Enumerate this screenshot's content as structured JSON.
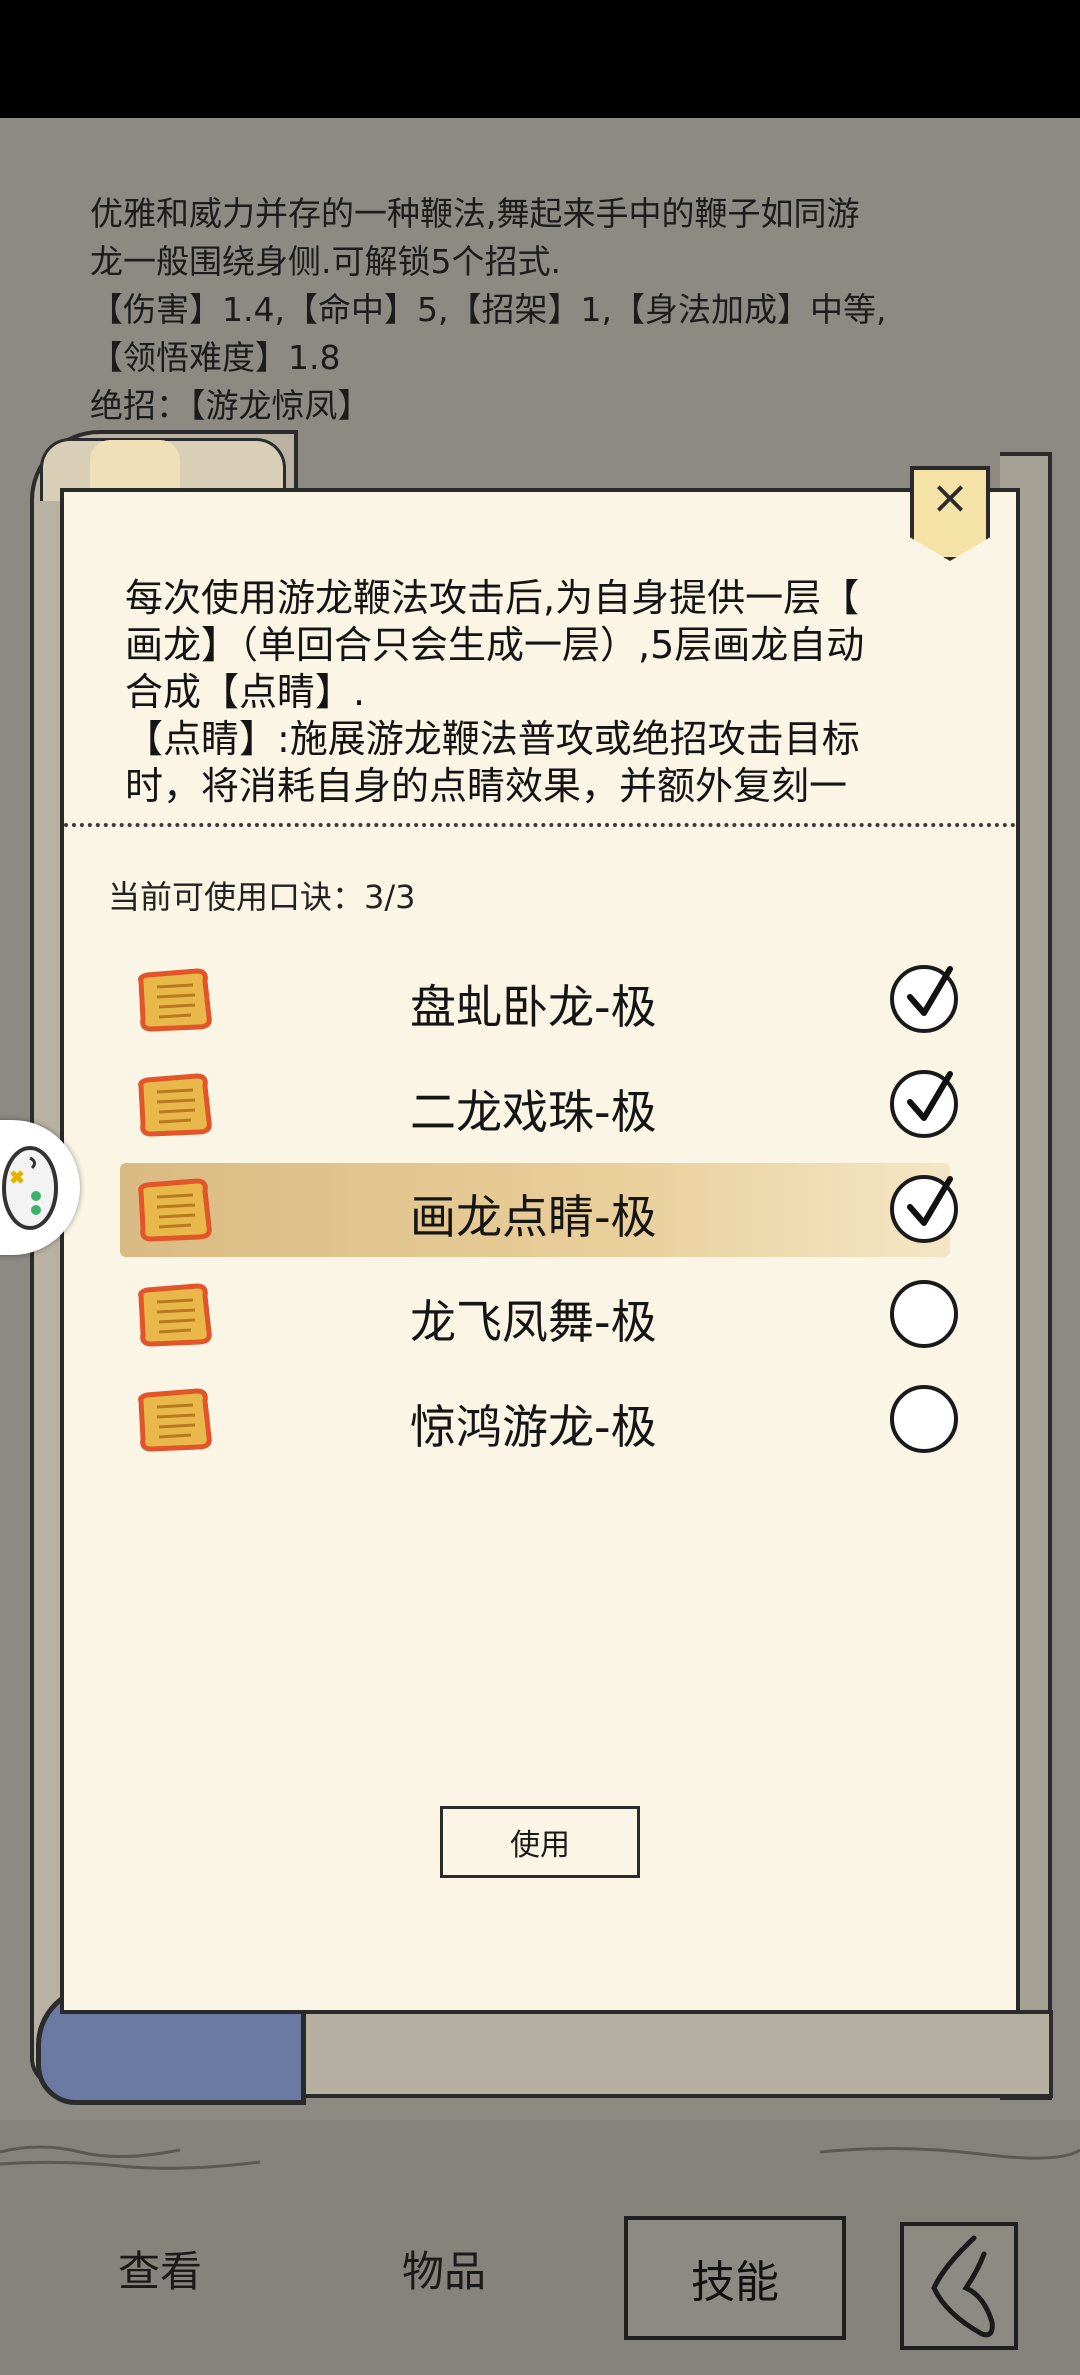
{
  "background_description": {
    "lines": [
      "优雅和威力并存的一种鞭法,舞起来手中的鞭子如同游",
      "龙一般围绕身侧.可解锁5个招式.",
      "【伤害】1.4,【命中】5,【招架】1,【身法加成】中等,",
      "【领悟难度】1.8",
      "绝招：【游龙惊凤】"
    ]
  },
  "dialog": {
    "close_label": "×",
    "description_lines": [
      "每次使用游龙鞭法攻击后,为自身提供一层【",
      "画龙】（单回合只会生成一层）,5层画龙自动",
      "合成【点睛】.",
      "【点睛】:施展游龙鞭法普攻或绝招攻击目标",
      "时，将消耗自身的点睛效果，并额外复刻一"
    ],
    "counter_label": "当前可使用口诀：3/3",
    "skills": [
      {
        "name": "盘虬卧龙-极",
        "checked": true
      },
      {
        "name": "二龙戏珠-极",
        "checked": true
      },
      {
        "name": "画龙点睛-极",
        "checked": true,
        "selected": true
      },
      {
        "name": "龙飞凤舞-极",
        "checked": false
      },
      {
        "name": "惊鸿游龙-极",
        "checked": false
      }
    ],
    "use_button": "使用"
  },
  "bottom_nav": {
    "tabs": [
      "查看",
      "物品",
      "技能"
    ],
    "active_tab": "技能",
    "back_icon": "back-arrow-icon"
  },
  "colors": {
    "background": "#8c8a83",
    "panel": "#fbf5e6",
    "selected_row": "#d9b779",
    "scroll_icon": "#e8b84a",
    "scroll_icon_glow": "#e2542a"
  }
}
